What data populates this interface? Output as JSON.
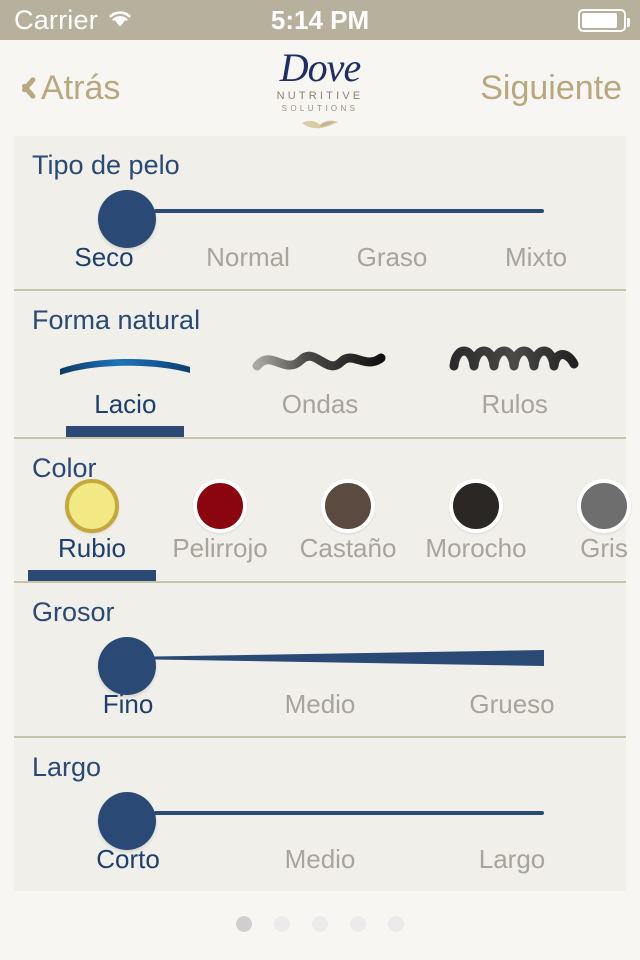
{
  "statusbar": {
    "carrier": "Carrier",
    "wifi_icon": "wifi-icon",
    "time": "5:14 PM",
    "battery_icon": "battery-icon"
  },
  "navbar": {
    "back_label": "Atrás",
    "next_label": "Siguiente",
    "logo": {
      "word": "Dove",
      "line1": "NUTRITIVE",
      "line2": "SOLUTIONS",
      "bird_icon": "dove-bird-icon"
    }
  },
  "theme": {
    "navy": "#2a4a75",
    "gold": "#b9a87f",
    "status_bg": "#b6b09c",
    "card_bg": "#f1efe9",
    "muted_text": "#a8a49c",
    "divider": "#c9c2ac"
  },
  "sections": [
    {
      "id": "tipo-de-pelo",
      "title": "Tipo de pelo",
      "control": "slider",
      "options": [
        "Seco",
        "Normal",
        "Graso",
        "Mixto"
      ],
      "selected_index": 0,
      "selected_value": "Seco"
    },
    {
      "id": "forma-natural",
      "title": "Forma natural",
      "control": "icon-options",
      "options": [
        {
          "label": "Lacio",
          "icon": "straight-hair-icon"
        },
        {
          "label": "Ondas",
          "icon": "wavy-hair-icon"
        },
        {
          "label": "Rulos",
          "icon": "curly-hair-icon"
        }
      ],
      "selected_index": 0,
      "selected_value": "Lacio"
    },
    {
      "id": "color",
      "title": "Color",
      "control": "swatch-options",
      "options": [
        {
          "label": "Rubio",
          "color": "#f2e884",
          "ring": "#c4a83c"
        },
        {
          "label": "Pelirrojo",
          "color": "#8b0510",
          "ring": "#ffffff"
        },
        {
          "label": "Castaño",
          "color": "#5b4a3f",
          "ring": "#ffffff"
        },
        {
          "label": "Morocho",
          "color": "#2a2725",
          "ring": "#ffffff"
        },
        {
          "label": "Gris",
          "color": "#6e6e6e",
          "ring": "#ffffff"
        }
      ],
      "selected_index": 0,
      "selected_value": "Rubio"
    },
    {
      "id": "grosor",
      "title": "Grosor",
      "control": "slider-taper",
      "options": [
        "Fino",
        "Medio",
        "Grueso"
      ],
      "selected_index": 0,
      "selected_value": "Fino"
    },
    {
      "id": "largo",
      "title": "Largo",
      "control": "slider",
      "options": [
        "Corto",
        "Medio",
        "Largo"
      ],
      "selected_index": 0,
      "selected_value": "Corto"
    }
  ],
  "pager": {
    "total": 5,
    "active_index": 0
  }
}
